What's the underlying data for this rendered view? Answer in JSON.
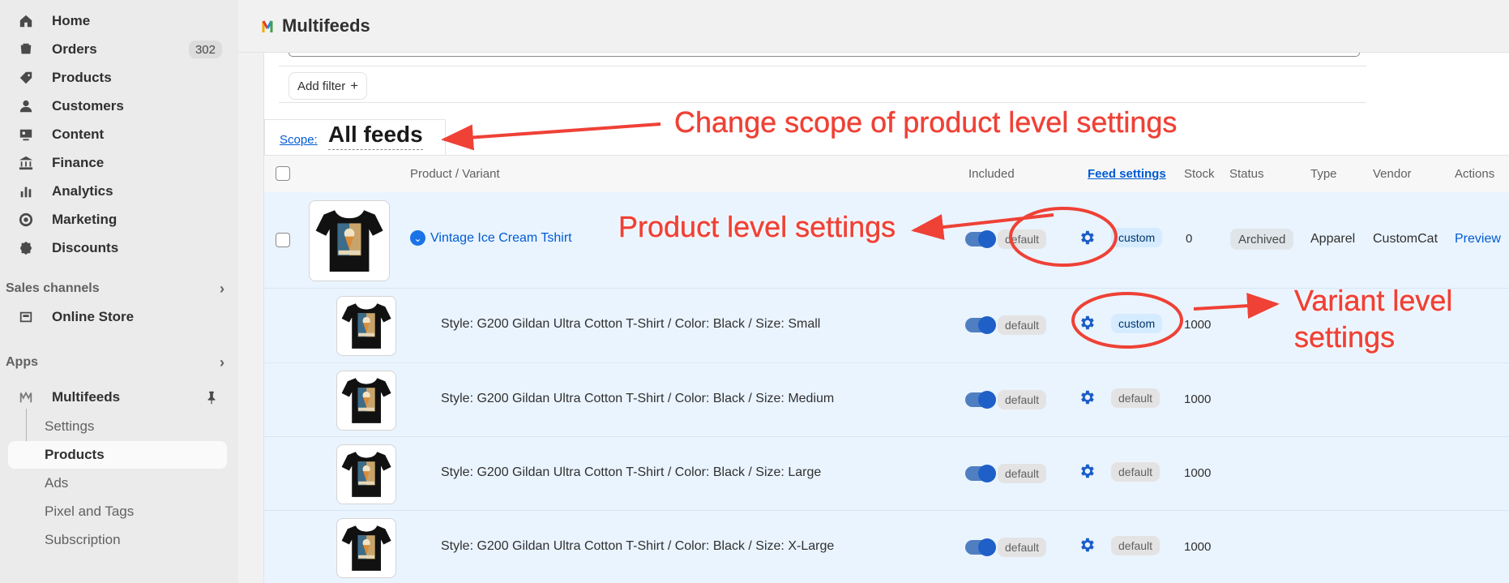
{
  "sidebar": {
    "items": [
      {
        "label": "Home",
        "icon": "home-icon"
      },
      {
        "label": "Orders",
        "icon": "orders-icon",
        "badge": "302"
      },
      {
        "label": "Products",
        "icon": "tag-icon"
      },
      {
        "label": "Customers",
        "icon": "person-icon"
      },
      {
        "label": "Content",
        "icon": "content-icon"
      },
      {
        "label": "Finance",
        "icon": "bank-icon"
      },
      {
        "label": "Analytics",
        "icon": "chart-bars-icon"
      },
      {
        "label": "Marketing",
        "icon": "target-icon"
      },
      {
        "label": "Discounts",
        "icon": "discount-icon"
      }
    ],
    "sales_channels_label": "Sales channels",
    "online_store_label": "Online Store",
    "apps_label": "Apps",
    "app_name": "Multifeeds",
    "app_sub_items": [
      "Settings",
      "Products",
      "Ads",
      "Pixel and Tags",
      "Subscription"
    ],
    "active_sub_item": "Products"
  },
  "header": {
    "title": "Multifeeds"
  },
  "toolbar": {
    "add_filter_label": "Add filter",
    "add_filter_plus": "+"
  },
  "scope": {
    "label": "Scope:",
    "value": "All feeds"
  },
  "table": {
    "columns": [
      "Product / Variant",
      "Included",
      "Feed settings",
      "Stock",
      "Status",
      "Type",
      "Vendor",
      "Actions"
    ],
    "product": {
      "name": "Vintage Ice Cream Tshirt",
      "included": "default",
      "feed_setting": "custom",
      "stock": "0",
      "status": "Archived",
      "type": "Apparel",
      "vendor": "CustomCat",
      "action": "Preview"
    },
    "variants": [
      {
        "name": "Style: G200 Gildan Ultra Cotton T-Shirt / Color: Black / Size: Small",
        "included": "default",
        "feed_setting": "custom",
        "stock": "1000"
      },
      {
        "name": "Style: G200 Gildan Ultra Cotton T-Shirt / Color: Black / Size: Medium",
        "included": "default",
        "feed_setting": "default",
        "stock": "1000"
      },
      {
        "name": "Style: G200 Gildan Ultra Cotton T-Shirt / Color: Black / Size: Large",
        "included": "default",
        "feed_setting": "default",
        "stock": "1000"
      },
      {
        "name": "Style: G200 Gildan Ultra Cotton T-Shirt / Color: Black / Size: X-Large",
        "included": "default",
        "feed_setting": "default",
        "stock": "1000"
      }
    ]
  },
  "annotations": {
    "scope_note": "Change scope of product level settings",
    "product_note": "Product level settings",
    "variant_note_line1": "Variant level",
    "variant_note_line2": "settings"
  },
  "colors": {
    "link": "#005bd3",
    "annotation": "#ef4136",
    "row_highlight": "#eaf4ff",
    "custom_pill": "#d5ebff"
  }
}
